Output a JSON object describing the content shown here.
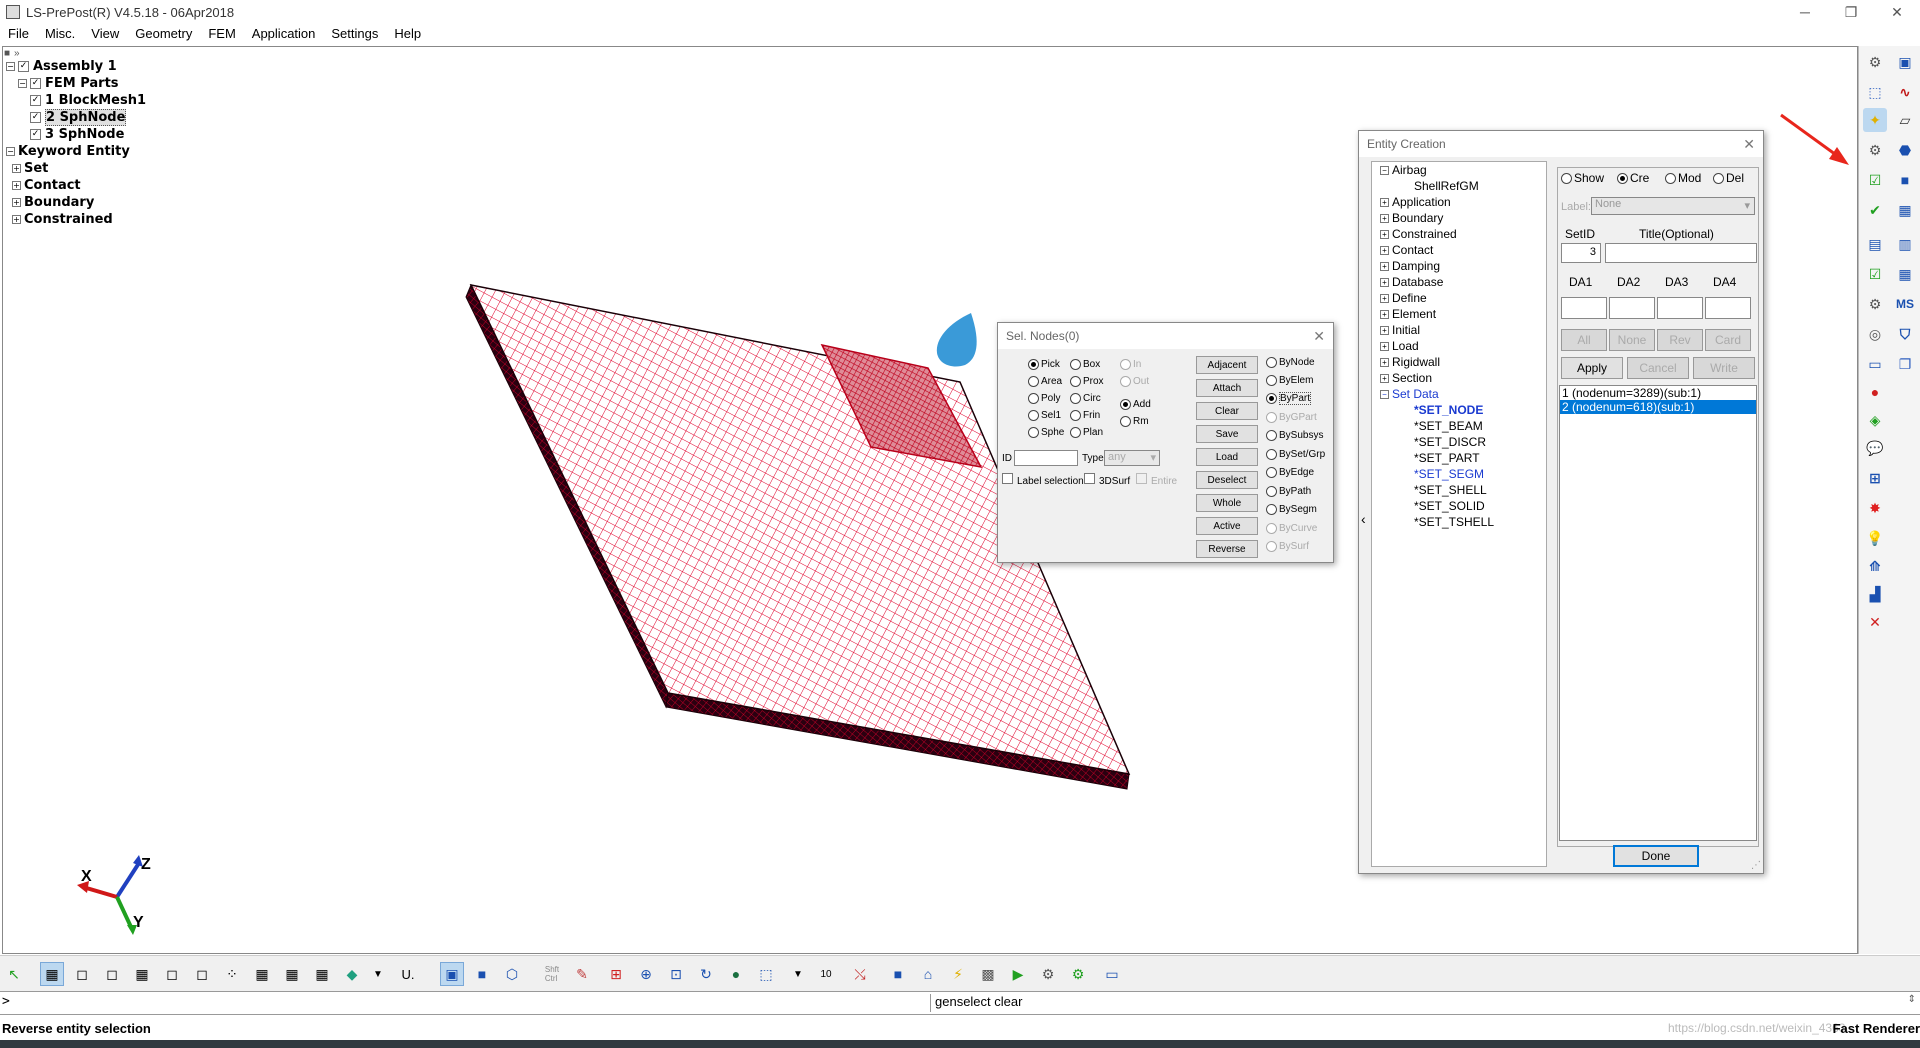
{
  "window": {
    "title": "LS-PrePost(R) V4.5.18 - 06Apr2018",
    "controls": [
      "─",
      "❐",
      "✕"
    ]
  },
  "menu": [
    "File",
    "Misc.",
    "View",
    "Geometry",
    "FEM",
    "Application",
    "Settings",
    "Help"
  ],
  "model_tree": {
    "assembly": "Assembly 1",
    "fem_parts": "FEM Parts",
    "parts": [
      "1 BlockMesh1",
      "2 SphNode",
      "3 SphNode"
    ],
    "keyword_entity": "Keyword Entity",
    "keywords": [
      "Set",
      "Contact",
      "Boundary",
      "Constrained"
    ]
  },
  "sel_nodes": {
    "title": "Sel. Nodes(0)",
    "modes": [
      "Pick",
      "Area",
      "Poly",
      "Sel1",
      "Sphe"
    ],
    "modes2": [
      "Box",
      "Prox",
      "Circ",
      "Frin",
      "Plan"
    ],
    "inout": [
      "In",
      "Out"
    ],
    "addrm": [
      "Add",
      "Rm"
    ],
    "id_label": "ID",
    "type_label": "Type",
    "type_value": "any",
    "label_selection": "Label selection",
    "surf3d": "3DSurf",
    "entire": "Entire",
    "buttons": [
      "Adjacent",
      "Attach",
      "Clear",
      "Save",
      "Load",
      "Deselect",
      "Whole",
      "Active",
      "Reverse"
    ],
    "by_options": [
      "ByNode",
      "ByElem",
      "ByPart",
      "ByGPart",
      "BySubsys",
      "BySet/Grp",
      "ByEdge",
      "ByPath",
      "BySegm",
      "ByCurve",
      "BySurf"
    ]
  },
  "entity_creation": {
    "title": "Entity Creation",
    "tree": [
      {
        "label": "Airbag",
        "type": "open"
      },
      {
        "label": "ShellRefGM",
        "type": "child"
      },
      {
        "label": "Application",
        "type": "closed"
      },
      {
        "label": "Boundary",
        "type": "closed"
      },
      {
        "label": "Constrained",
        "type": "closed"
      },
      {
        "label": "Contact",
        "type": "closed"
      },
      {
        "label": "Damping",
        "type": "closed"
      },
      {
        "label": "Database",
        "type": "closed"
      },
      {
        "label": "Define",
        "type": "closed"
      },
      {
        "label": "Element",
        "type": "closed"
      },
      {
        "label": "Initial",
        "type": "closed"
      },
      {
        "label": "Load",
        "type": "closed"
      },
      {
        "label": "Rigidwall",
        "type": "closed"
      },
      {
        "label": "Section",
        "type": "closed"
      },
      {
        "label": "Set Data",
        "type": "open-blue"
      }
    ],
    "set_children": [
      "*SET_NODE",
      "*SET_BEAM",
      "*SET_DISCR",
      "*SET_PART",
      "*SET_SEGM",
      "*SET_SHELL",
      "*SET_SOLID",
      "*SET_TSHELL"
    ],
    "mode_radios": [
      "Show",
      "Cre",
      "Mod",
      "Del"
    ],
    "label_caption": "Label:",
    "label_value": "None",
    "setid_caption": "SetID",
    "setid_value": "3",
    "title_caption": "Title(Optional)",
    "da_labels": [
      "DA1",
      "DA2",
      "DA3",
      "DA4"
    ],
    "sel_buttons": [
      "All",
      "None",
      "Rev",
      "Card"
    ],
    "action_buttons": [
      "Apply",
      "Cancel",
      "Write"
    ],
    "sets": [
      "1 (nodenum=3289)(sub:1)",
      "2 (nodenum=618)(sub:1)"
    ],
    "done": "Done"
  },
  "bottom_toolbar": {
    "shift_ctrl": "Shft\nCtrl",
    "number": "10",
    "u_label": "U."
  },
  "axes": {
    "x": "X",
    "y": "Y",
    "z": "Z"
  },
  "command": {
    "prompt": ">",
    "echo": "genselect clear"
  },
  "status": {
    "message": "Reverse entity selection",
    "renderer": "Fast Renderer",
    "watermark": "https://blog.csdn.net/weixin_4363..."
  },
  "colors": {
    "mesh_red": "#e0002a",
    "dark_edge": "#1a0008",
    "highlight_red": "#b8001a",
    "sph_blue": "#3a9ad8",
    "arrow_red": "#e8261c",
    "selection_blue": "#0078d7"
  }
}
